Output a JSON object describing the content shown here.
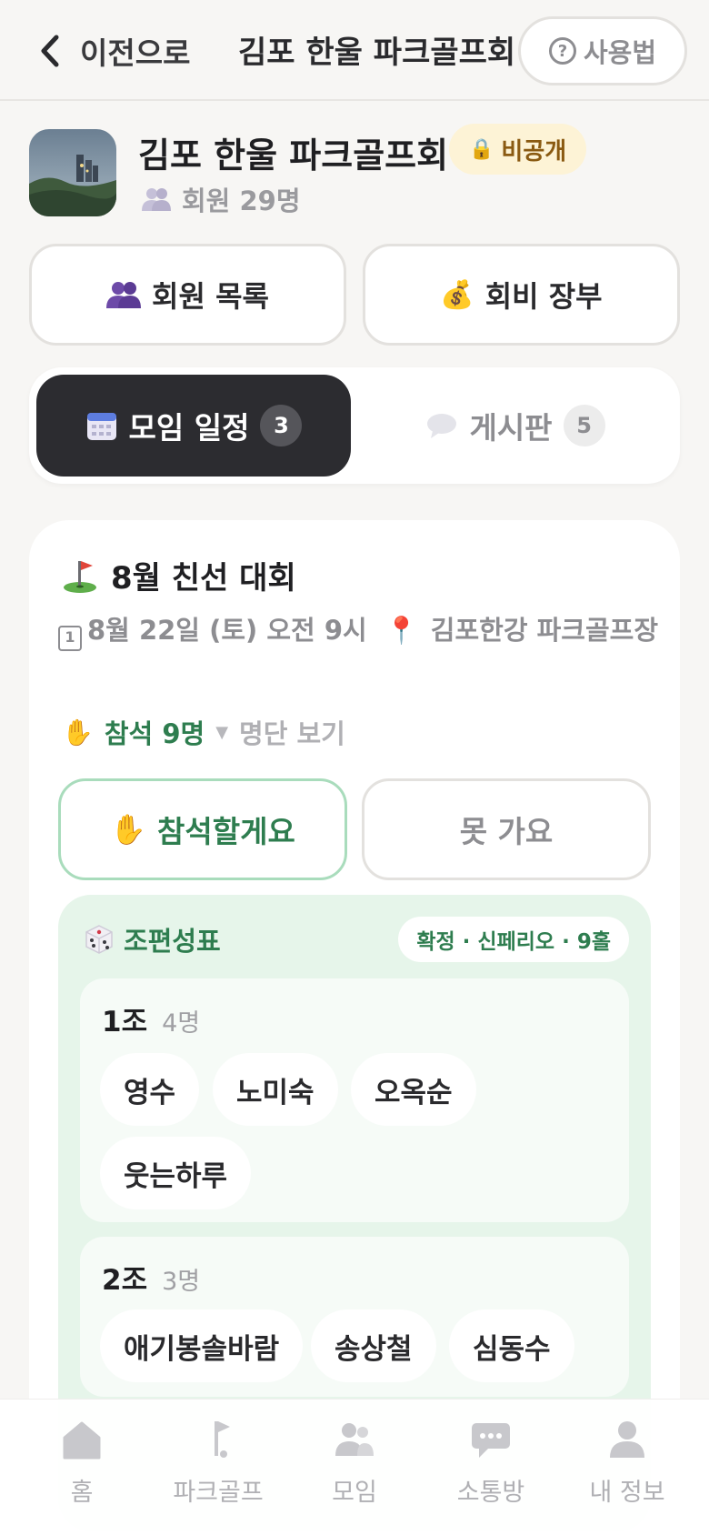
{
  "header": {
    "back_label": "이전으로",
    "title": "김포 한울 파크골프회",
    "help_label": "사용법"
  },
  "club": {
    "name": "김포 한울 파크골프회",
    "privacy_badge": "비공개",
    "member_count": "회원 29명"
  },
  "actions": {
    "members_label": "회원 목록",
    "dues_label": "회비 장부"
  },
  "tabs": [
    {
      "label": "모임 일정",
      "count": "3",
      "active": true
    },
    {
      "label": "게시판",
      "count": "5",
      "active": false
    }
  ],
  "event": {
    "title": "8월 친선 대회",
    "date": "8월 22일 (토) 오전 9시",
    "location": "김포한강 파크골프장",
    "attendance": "참석 9명",
    "attendee_list_label": "명단 보기",
    "rsvp_yes": "참석할게요",
    "rsvp_no": "못 가요"
  },
  "teams": {
    "title": "조편성표",
    "status": "확정 · 신페리오 · 9홀",
    "groups": [
      {
        "name": "1조",
        "count": "4명",
        "members": [
          "영수",
          "노미숙",
          "오옥순",
          "웃는하루"
        ]
      },
      {
        "name": "2조",
        "count": "3명",
        "members": [
          "애기봉솔바람",
          "송상철",
          "심동수"
        ]
      }
    ]
  },
  "bottom_nav": [
    {
      "label": "홈",
      "icon": "home-icon"
    },
    {
      "label": "파크골프",
      "icon": "golf-flag-icon"
    },
    {
      "label": "모임",
      "icon": "group-icon"
    },
    {
      "label": "소통방",
      "icon": "chat-icon"
    },
    {
      "label": "내 정보",
      "icon": "person-icon"
    }
  ],
  "colors": {
    "accent_green": "#2e7d4f",
    "dark_tab": "#2c2c30",
    "private_badge_bg": "#fdf3d6",
    "team_box_bg": "#e6f5ea"
  }
}
